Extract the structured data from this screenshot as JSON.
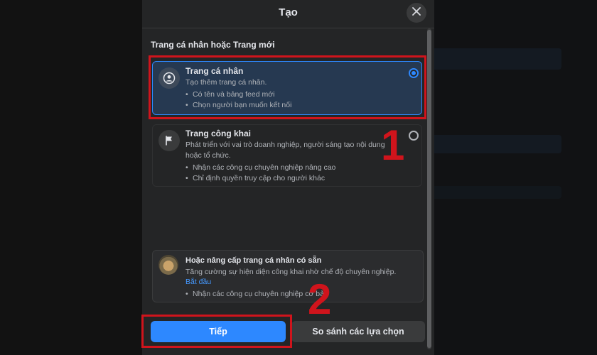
{
  "dialog": {
    "title": "Tạo",
    "close_icon": "close-icon"
  },
  "section_title": "Trang cá nhân hoặc Trang mới",
  "options": [
    {
      "title": "Trang cá nhân",
      "description": "Tạo thêm trang cá nhân.",
      "bullets": [
        "Có tên và bảng feed mới",
        "Chọn người bạn muốn kết nối"
      ],
      "icon": "person-icon",
      "selected": true
    },
    {
      "title": "Trang công khai",
      "description_line1": "Phát triển với vai trò doanh nghiệp, người sáng tạo nội dung",
      "description_line2": "hoặc tổ chức.",
      "bullets": [
        "Nhận các công cụ chuyên nghiệp nâng cao",
        "Chỉ định quyền truy cập cho người khác"
      ],
      "icon": "flag-icon",
      "selected": false
    }
  ],
  "upgrade": {
    "title": "Hoặc nâng cấp trang cá nhân có sẵn",
    "description": "Tăng cường sự hiện diện công khai nhờ chế độ chuyên nghiệp.",
    "link": "Bắt đầu",
    "bullet": "Nhận các công cụ chuyên nghiệp cơ bản"
  },
  "footer": {
    "next_label": "Tiếp",
    "compare_label": "So sánh các lựa chọn"
  },
  "annotations": {
    "step1": "1",
    "step2": "2"
  },
  "colors": {
    "accent": "#2d88ff",
    "annotation_red": "#d0141c",
    "dialog_bg": "#242526"
  }
}
